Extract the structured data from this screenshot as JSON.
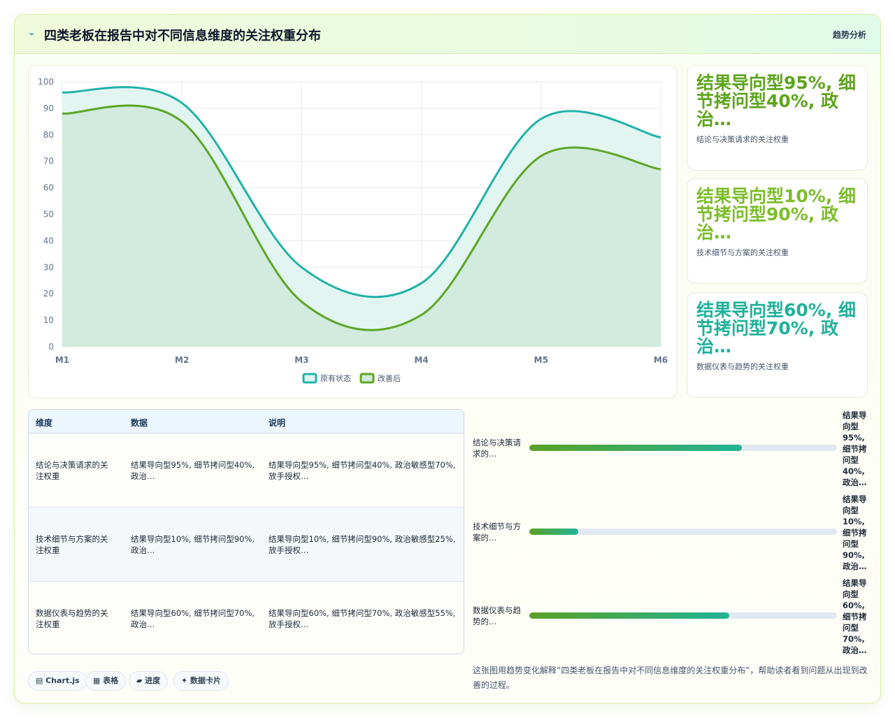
{
  "header": {
    "icon": "trend-line-icon",
    "icon_glyph": "⌁",
    "title": "四类老板在报告中对不同信息维度的关注权重分布",
    "link_label": "趋势分析"
  },
  "chart_data": {
    "type": "area",
    "categories": [
      "M1",
      "M2",
      "M3",
      "M4",
      "M5",
      "M6"
    ],
    "ylim": [
      0,
      100
    ],
    "yticks": [
      0,
      10,
      20,
      30,
      40,
      50,
      60,
      70,
      80,
      90,
      100
    ],
    "grid": true,
    "legend_position": "bottom",
    "series": [
      {
        "name": "原有状态",
        "values": [
          96,
          92,
          30,
          24,
          86,
          79
        ],
        "color": "#20b2a6",
        "fill": "#dff4f0"
      },
      {
        "name": "改善后",
        "values": [
          88,
          85,
          17,
          12,
          72,
          67
        ],
        "color": "#5da625",
        "fill": "#cfeadb"
      }
    ]
  },
  "stats": [
    {
      "value": "结果导向型95%, 细节拷问型40%, 政治…",
      "label": "结论与决策请求的关注权重",
      "color": "#5ea41c"
    },
    {
      "value": "结果导向型10%, 细节拷问型90%, 政治…",
      "label": "技术细节与方案的关注权重",
      "color": "#7cbd2a"
    },
    {
      "value": "结果导向型60%, 细节拷问型70%, 政治…",
      "label": "数据仪表与趋势的关注权重",
      "color": "#1fb29a"
    }
  ],
  "table": {
    "headers": [
      "维度",
      "数据",
      "说明"
    ],
    "rows": [
      {
        "dim": "结论与决策请求的关\n注权重",
        "data": "结果导向型95%, 细节拷问型40%,\n政治…",
        "note": "结果导向型95%, 细节拷问型40%, 政治敏感型70%,\n放手授权…"
      },
      {
        "dim": "技术细节与方案的关\n注权重",
        "data": "结果导向型10%, 细节拷问型90%,\n政治…",
        "note": "结果导向型10%, 细节拷问型90%, 政治敏感型25%,\n放手授权…"
      },
      {
        "dim": "数据仪表与趋势的关\n注权重",
        "data": "结果导向型60%, 细节拷问型70%,\n政治…",
        "note": "结果导向型60%, 细节拷问型70%, 政治敏感型55%,\n放手授权…"
      }
    ]
  },
  "progress": [
    {
      "label": "结论与决策请\n求的…",
      "value": "结果导\n向型\n95%,\n细节拷\n问型\n40%,\n政治…",
      "fraction": 0.69
    },
    {
      "label": "技术细节与方\n案的…",
      "value": "结果导\n向型\n10%,\n细节拷\n问型\n90%,\n政治…",
      "fraction": 0.16
    },
    {
      "label": "数据仪表与趋\n势的…",
      "value": "结果导\n向型\n60%,\n细节拷\n问型\n70%,\n政治…",
      "fraction": 0.65
    }
  ],
  "chips": [
    {
      "icon": "chart-icon",
      "label": "▤ Chart.js"
    },
    {
      "icon": "table-icon",
      "label": "▦ 表格"
    },
    {
      "icon": "progress-icon",
      "label": "▰ 进度"
    },
    {
      "icon": "sparkle-icon",
      "label": "✦ 数据卡片"
    }
  ],
  "caption": "这张图用趋势变化解释“四类老板在报告中对不同信息维度的关注权重分布”，帮助读者看到问题从出现到改善的过程。"
}
